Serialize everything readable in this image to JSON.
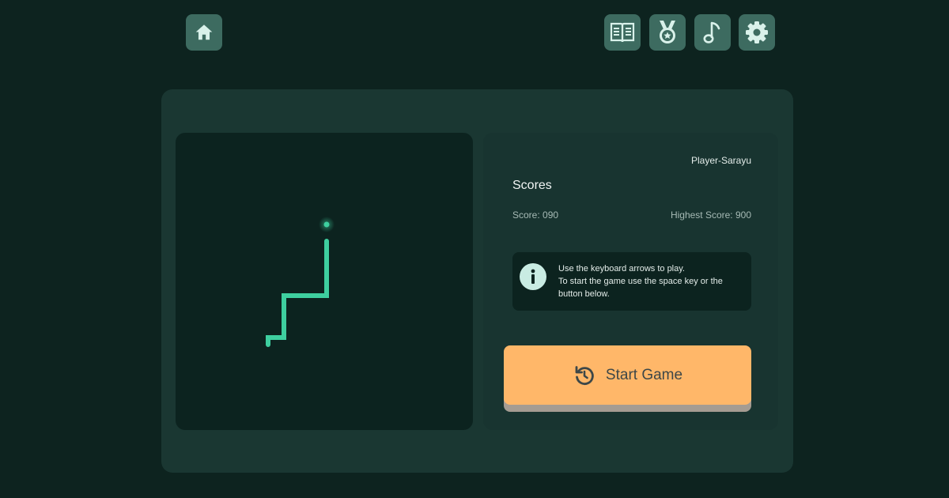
{
  "nav": {
    "home_icon": "home-icon",
    "rules_icon": "open-book-icon",
    "awards_icon": "medal-icon",
    "music_icon": "music-note-icon",
    "settings_icon": "gear-icon"
  },
  "game": {
    "snake_color": "#3ecf9f",
    "food_color": "#3ecf9f"
  },
  "info": {
    "player": "Player-Sarayu",
    "scores_title": "Scores",
    "score": "Score: 090",
    "highest_score": "Highest Score: 900",
    "tip_line1": "Use the keyboard arrows to play.",
    "tip_line2": "To start the game use the space key or the button below.",
    "start_label": "Start Game",
    "start_icon": "restart-icon"
  },
  "colors": {
    "background": "#0d231f",
    "panel": "#1a3732",
    "button_accent": "#ffb769"
  }
}
